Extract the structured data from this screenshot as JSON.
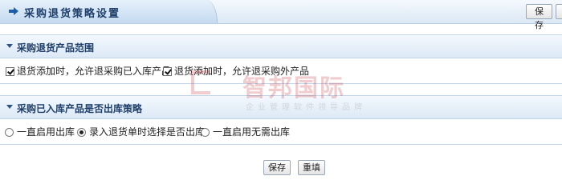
{
  "header": {
    "title": "采购退货策略设置",
    "save_label": "保存"
  },
  "sections": [
    {
      "title": "采购退货产品范围",
      "options": [
        {
          "label": "退货添加时，允许退采购已入库产品",
          "checked": true
        },
        {
          "label": "退货添加时，允许退采购外产品",
          "checked": true
        }
      ]
    },
    {
      "title": "采购已入库产品是否出库策略",
      "options": [
        {
          "label": "一直启用出库",
          "selected": false
        },
        {
          "label": "录入退货单时选择是否出库",
          "selected": true
        },
        {
          "label": "一直启用无需出库",
          "selected": false
        }
      ]
    }
  ],
  "footer": {
    "save_label": "保存",
    "reset_label": "重填"
  },
  "watermark": {
    "name": "智邦国际",
    "tagline": "企业管理软件领导品牌"
  },
  "colors": {
    "header_text": "#1f3f6a",
    "accent": "#1d5ea8",
    "watermark": "#c21c24"
  }
}
